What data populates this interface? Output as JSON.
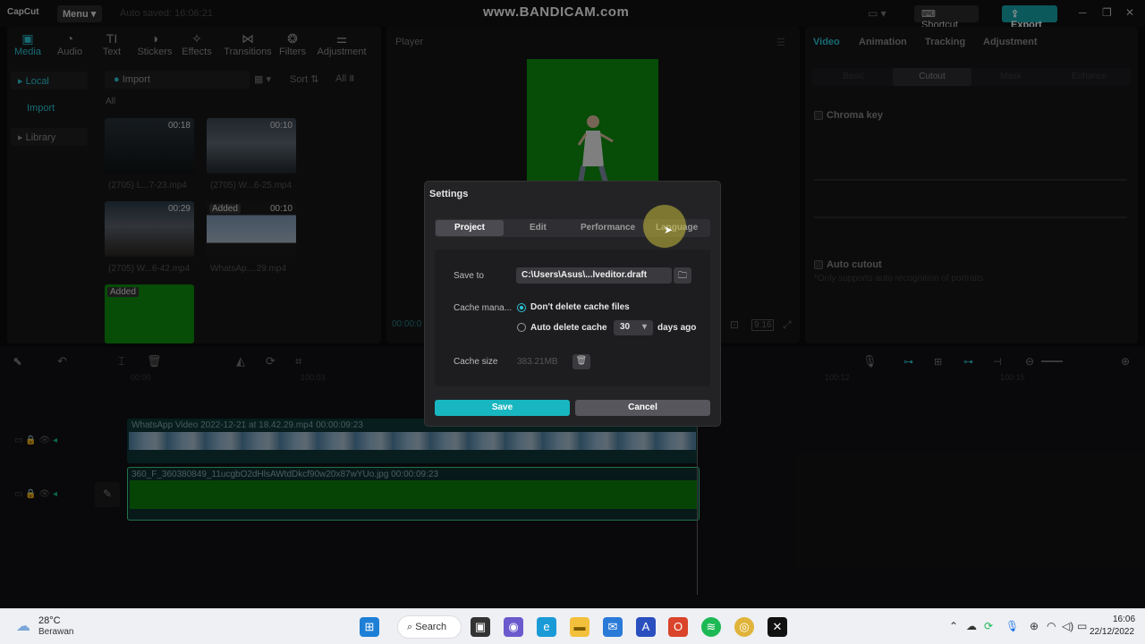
{
  "titlebar": {
    "logo": "CapCut",
    "menu": "Menu",
    "autosave": "Auto saved: 16:06:21",
    "watermark": "www.BANDICAM.com",
    "shortcut": "Shortcut",
    "export": "Export"
  },
  "toolbar": {
    "items": [
      {
        "label": "Media",
        "icon": "media-icon",
        "glyph": "▣"
      },
      {
        "label": "Audio",
        "icon": "audio-icon",
        "glyph": "◔"
      },
      {
        "label": "Text",
        "icon": "text-icon",
        "glyph": "TI"
      },
      {
        "label": "Stickers",
        "icon": "stickers-icon",
        "glyph": "◑"
      },
      {
        "label": "Effects",
        "icon": "effects-icon",
        "glyph": "✧"
      },
      {
        "label": "Transitions",
        "icon": "transitions-icon",
        "glyph": "⋈"
      },
      {
        "label": "Filters",
        "icon": "filters-icon",
        "glyph": "❂"
      },
      {
        "label": "Adjustment",
        "icon": "adjustment-icon",
        "glyph": "⚌"
      }
    ]
  },
  "sidebar": {
    "local": "Local",
    "import": "Import",
    "library": "Library"
  },
  "media": {
    "import": "Import",
    "sort": "Sort",
    "all_filter": "All",
    "all_label": "All",
    "items": [
      {
        "duration": "00:18",
        "caption": "(2705) L...7-23.mp4",
        "added": ""
      },
      {
        "duration": "00:10",
        "caption": "(2705) W...6-25.mp4",
        "added": ""
      },
      {
        "duration": "00:29",
        "caption": "(2705) W...6-42.mp4",
        "added": ""
      },
      {
        "duration": "00:10",
        "caption": "WhatsAp....29.mp4",
        "added": "Added"
      },
      {
        "duration": "",
        "caption": "",
        "added": "Added"
      }
    ]
  },
  "player": {
    "title": "Player",
    "time": "00:00:0",
    "ratio": "9:16"
  },
  "right": {
    "tabs": [
      "Video",
      "Animation",
      "Tracking",
      "Adjustment"
    ],
    "subtabs": [
      "Basic",
      "Cutout",
      "Mask",
      "Enhance"
    ],
    "chroma": "Chroma key",
    "autocutout": "Auto cutout",
    "autocutout_note": "*Only supports auto recognition of portraits"
  },
  "timeline": {
    "ruler": [
      "00:00",
      "100:03",
      "100:12",
      "100:15"
    ],
    "track1": "WhatsApp Video 2022-12-21 at 18.42.29.mp4    00:00:09:23",
    "track2": "360_F_360380849_11ucgbO2dHlsAWtdDkcf90w20x87wYUo.jpg    00:00:09:23"
  },
  "dialog": {
    "title": "Settings",
    "tabs": [
      "Project",
      "Edit",
      "Performance",
      "Language"
    ],
    "save_to_label": "Save to",
    "save_to_value": "C:\\Users\\Asus\\...lveditor.draft",
    "cache_label": "Cache mana...",
    "opt_dont_delete": "Don't delete cache files",
    "opt_auto_delete": "Auto delete cache",
    "days_value": "30",
    "days_suffix": "days ago",
    "cache_size_label": "Cache size",
    "cache_size_value": "383.21MB",
    "save": "Save",
    "cancel": "Cancel"
  },
  "taskbar": {
    "temp": "28°C",
    "weather": "Berawan",
    "search": "Search",
    "time": "16:06",
    "date": "22/12/2022"
  },
  "colors": {
    "accent": "#2cc3d1",
    "export": "#16a3a8",
    "green_screen": "#0d8a0d"
  }
}
